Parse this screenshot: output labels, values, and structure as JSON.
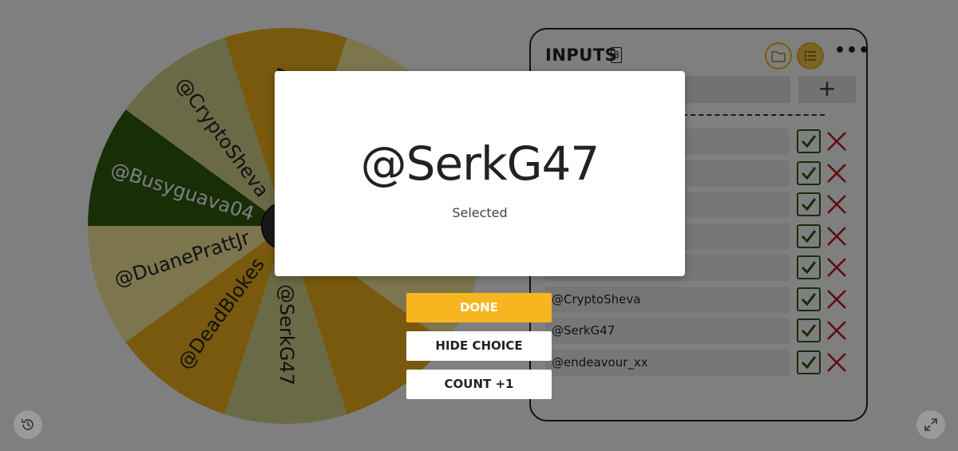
{
  "wheel": {
    "segments": [
      {
        "label": "@SerkG47",
        "color": "#f0b21a"
      },
      {
        "label": "@endeavour_xx",
        "color": "#f9eb9c"
      },
      {
        "label": "",
        "color": "#f0b21a"
      },
      {
        "label": "",
        "color": "#f9eb9c"
      },
      {
        "label": "",
        "color": "#f0b21a"
      },
      {
        "label": "@SerkG47",
        "color": "#d7d58c"
      },
      {
        "label": "@DeadBlokes",
        "color": "#f0b21a"
      },
      {
        "label": "@DuanePrattJr",
        "color": "#f9eb9c"
      },
      {
        "label": "@Busyguava04",
        "color": "#2e5d0f"
      },
      {
        "label": "@CryptoSheva",
        "color": "#d7d58c"
      }
    ]
  },
  "inputs": {
    "title": "INPUTS",
    "count": "8",
    "more_label": "•••",
    "add_label": "+",
    "entries": [
      {
        "label": ""
      },
      {
        "label": ""
      },
      {
        "label": ""
      },
      {
        "label": ""
      },
      {
        "label": ""
      },
      {
        "label": "@CryptoSheva"
      },
      {
        "label": "@SerkG47"
      },
      {
        "label": "@endeavour_xx"
      }
    ]
  },
  "modal": {
    "winner": "@SerkG47",
    "subtitle": "Selected"
  },
  "buttons": {
    "done": "DONE",
    "hide_choice": "HIDE CHOICE",
    "count": "COUNT +1"
  },
  "colors": {
    "accent": "#f7b51f",
    "check": "#2c5a12",
    "delete": "#c0141c"
  },
  "icons": {
    "folder": "folder-icon",
    "list": "list-icon",
    "history": "history-icon",
    "expand": "expand-icon"
  }
}
